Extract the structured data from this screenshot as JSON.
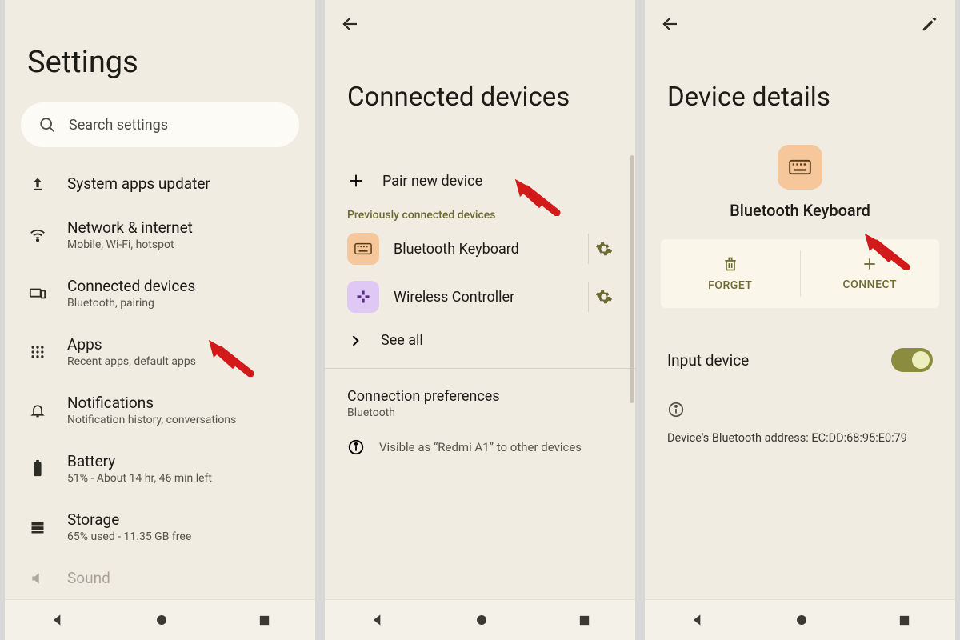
{
  "panel1": {
    "title": "Settings",
    "search_placeholder": "Search settings",
    "items": [
      {
        "label": "System apps updater",
        "sub": ""
      },
      {
        "label": "Network & internet",
        "sub": "Mobile, Wi-Fi, hotspot"
      },
      {
        "label": "Connected devices",
        "sub": "Bluetooth, pairing"
      },
      {
        "label": "Apps",
        "sub": "Recent apps, default apps"
      },
      {
        "label": "Notifications",
        "sub": "Notification history, conversations"
      },
      {
        "label": "Battery",
        "sub": "51% - About 14 hr, 46 min left"
      },
      {
        "label": "Storage",
        "sub": "65% used - 11.35 GB free"
      },
      {
        "label": "Sound",
        "sub": ""
      }
    ]
  },
  "panel2": {
    "title": "Connected devices",
    "pair_label": "Pair new device",
    "section_label": "Previously connected devices",
    "devices": [
      {
        "name": "Bluetooth Keyboard"
      },
      {
        "name": "Wireless Controller"
      }
    ],
    "see_all": "See all",
    "conn_pref_label": "Connection preferences",
    "conn_pref_sub": "Bluetooth",
    "visible_text": "Visible as “Redmi A1” to other devices"
  },
  "panel3": {
    "title": "Device details",
    "device_name": "Bluetooth Keyboard",
    "forget": "FORGET",
    "connect": "CONNECT",
    "toggle_label": "Input device",
    "toggle_on": true,
    "address_text": "Device's Bluetooth address: EC:DD:68:95:E0:79"
  }
}
